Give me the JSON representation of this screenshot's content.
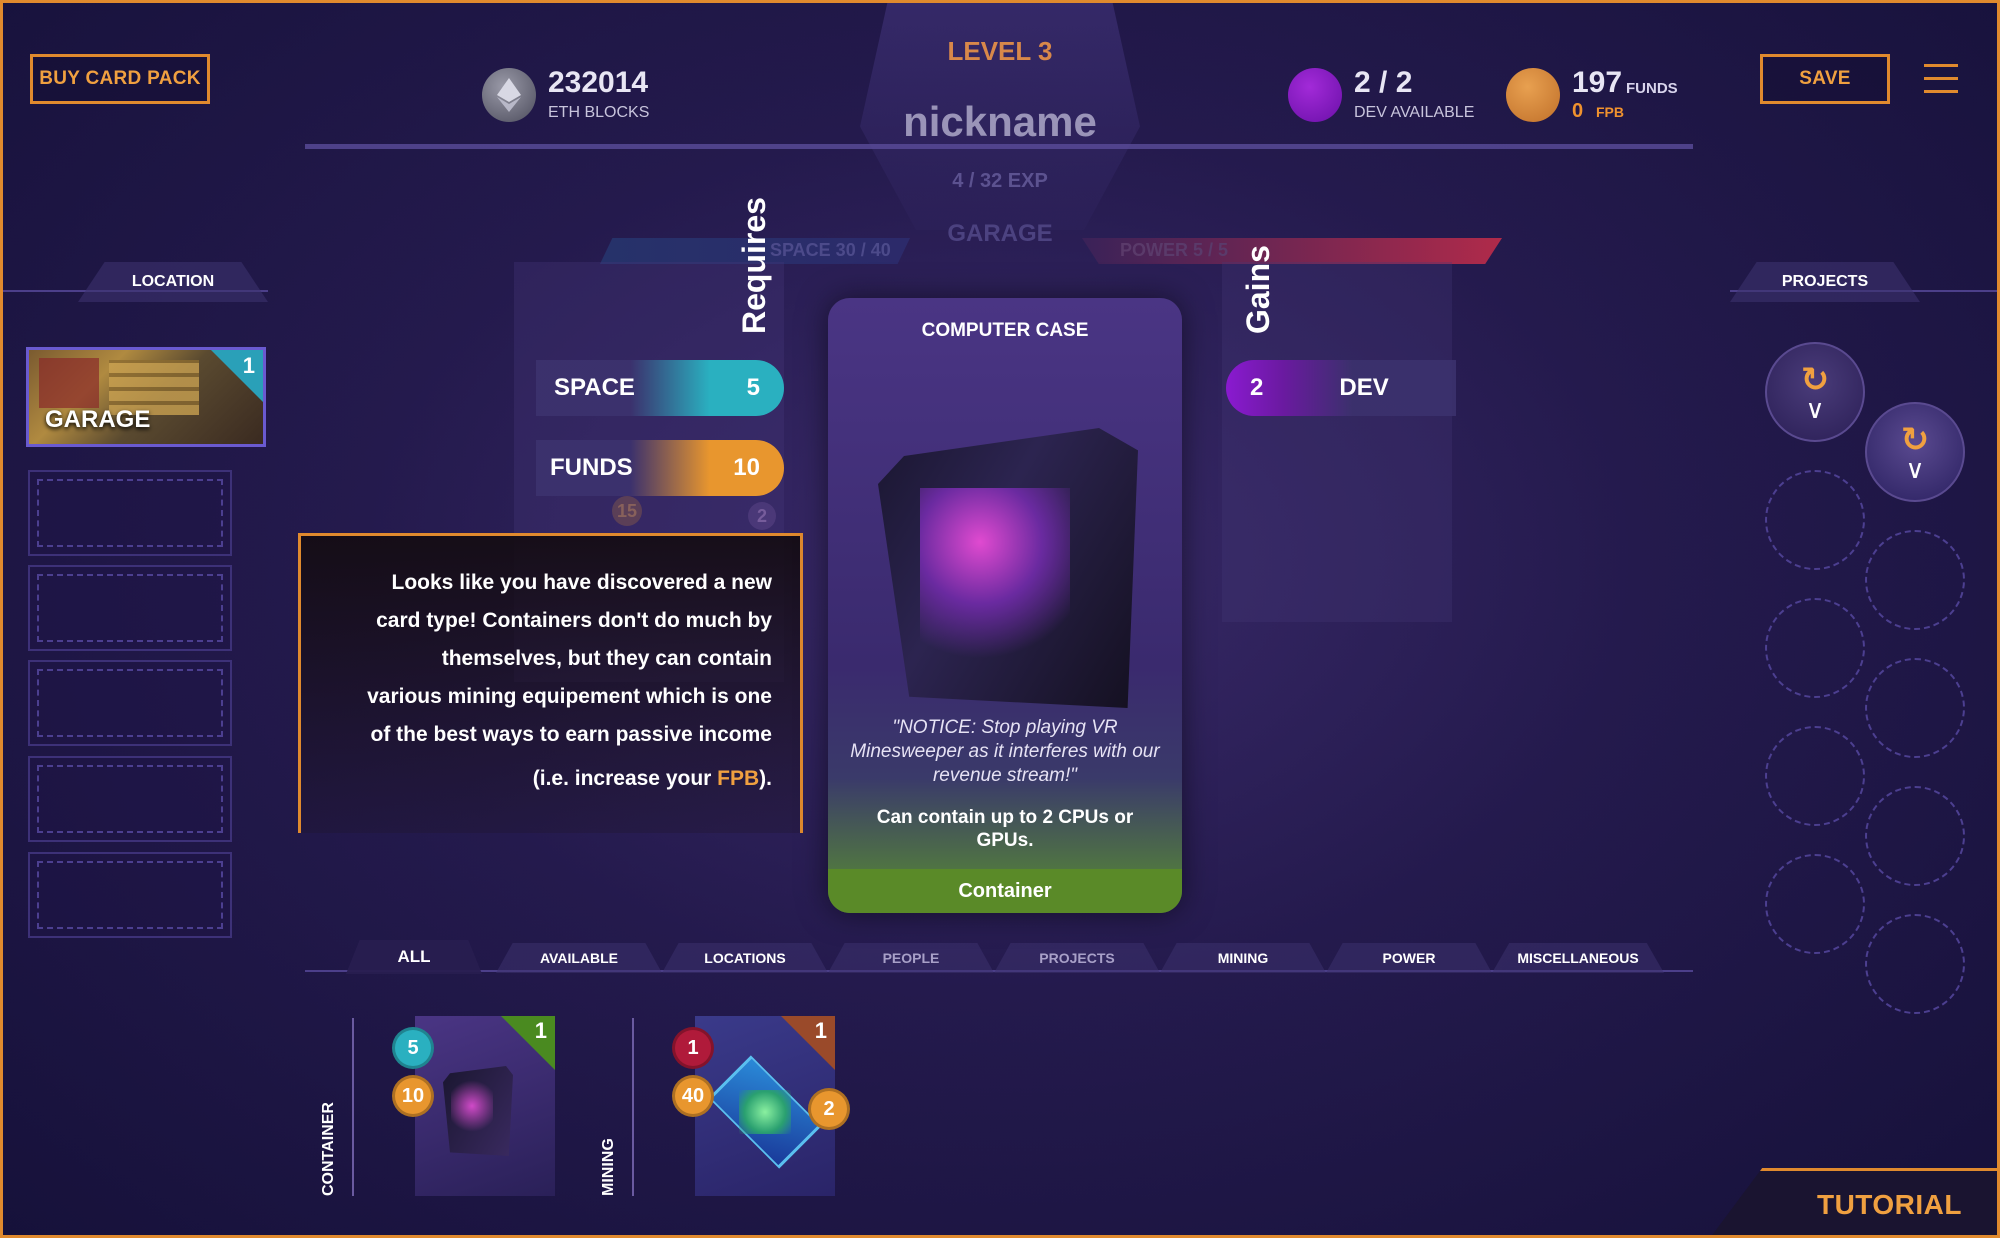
{
  "header": {
    "buy_button": "BUY CARD PACK",
    "save_button": "SAVE",
    "level": "LEVEL 3",
    "nickname": "nickname",
    "exp": "4 / 32 EXP",
    "location_name": "GARAGE",
    "space_bar": "SPACE 30 / 40",
    "power_bar": "POWER 5 / 5",
    "eth_value": "232014",
    "eth_label": "ETH BLOCKS",
    "dev_value": "2 / 2",
    "dev_label": "DEV AVAILABLE",
    "funds_value": "197",
    "funds_label": "FUNDS",
    "fpb_value": "0",
    "fpb_label": "FPB"
  },
  "location_panel": {
    "tab": "LOCATION",
    "garage_label": "GARAGE",
    "garage_count": "1"
  },
  "projects_panel": {
    "tab": "PROJECTS"
  },
  "requires": {
    "title": "Requires",
    "items": [
      {
        "label": "SPACE",
        "value": "5"
      },
      {
        "label": "FUNDS",
        "value": "10"
      }
    ],
    "ghost_values": [
      "15",
      "2"
    ]
  },
  "gains": {
    "title": "Gains",
    "items": [
      {
        "label": "DEV",
        "value": "2"
      }
    ]
  },
  "tooltip": {
    "line1": "Looks like you have discovered a new",
    "line2": "card type! Containers don't do much by",
    "line3": "themselves, but they can contain",
    "line4": "various mining equipement which is one",
    "line5": "of the best ways to earn passive income",
    "line6_prefix": "(i.e. increase your ",
    "line6_highlight": "FPB",
    "line6_suffix": ")."
  },
  "card": {
    "title": "COMPUTER CASE",
    "quote": "\"NOTICE: Stop playing VR Minesweeper as it interferes with our revenue stream!\"",
    "description": "Can contain up to 2 CPUs or GPUs.",
    "type": "Container"
  },
  "categories": {
    "tabs": [
      "ALL",
      "AVAILABLE",
      "LOCATIONS",
      "PEOPLE",
      "PROJECTS",
      "MINING",
      "POWER",
      "MISCELLANEOUS"
    ]
  },
  "hand": {
    "groups": [
      {
        "label": "CONTAINER",
        "cards": [
          {
            "count": "1",
            "badges": [
              "5",
              "10"
            ]
          }
        ]
      },
      {
        "label": "MINING",
        "cards": [
          {
            "count": "1",
            "badges": [
              "1",
              "40",
              "2"
            ]
          }
        ]
      }
    ]
  },
  "tutorial_button": "TUTORIAL",
  "colors": {
    "accent": "#e08a2e",
    "space": "#2ab0c0",
    "funds": "#e8962e",
    "dev": "#8a1ad0",
    "container": "#5a8a28"
  }
}
